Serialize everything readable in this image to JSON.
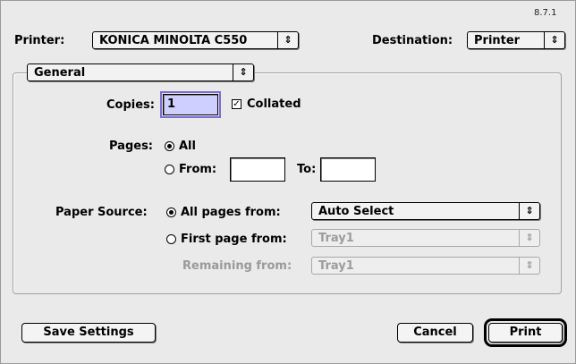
{
  "version": "8.7.1",
  "printer": {
    "label": "Printer:",
    "value": "KONICA MINOLTA C550"
  },
  "destination": {
    "label": "Destination:",
    "value": "Printer"
  },
  "panel": {
    "value": "General"
  },
  "copies": {
    "label": "Copies:",
    "value": "1",
    "collated_label": "Collated",
    "collated_checked": true
  },
  "pages": {
    "label": "Pages:",
    "all_label": "All",
    "from_label": "From:",
    "to_label": "To:",
    "from_value": "",
    "to_value": ""
  },
  "paper_source": {
    "label": "Paper Source:",
    "all_pages_label": "All pages from:",
    "all_pages_value": "Auto Select",
    "first_page_label": "First page from:",
    "first_page_value": "Tray1",
    "remaining_label": "Remaining from:",
    "remaining_value": "Tray1"
  },
  "buttons": {
    "save": "Save Settings",
    "cancel": "Cancel",
    "print": "Print"
  },
  "icons": {
    "popup_arrow": "⇕",
    "checkmark": "✓"
  }
}
